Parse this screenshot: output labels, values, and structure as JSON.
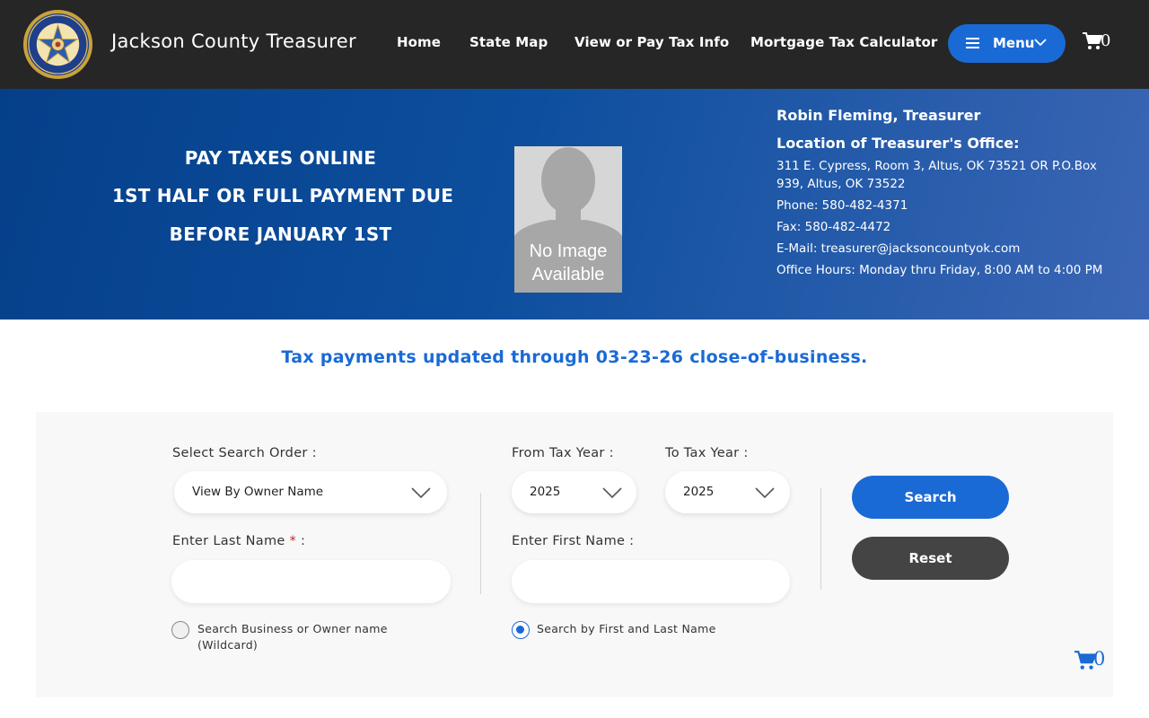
{
  "header": {
    "site_title": "Jackson County Treasurer",
    "nav": [
      {
        "label": "Home"
      },
      {
        "label": "State Map"
      },
      {
        "label": "View or Pay Tax Info"
      },
      {
        "label": "Mortgage Tax Calculator"
      }
    ],
    "menu_label": "Menu",
    "cart_count": "0"
  },
  "banner": {
    "promo_lines": [
      "PAY TAXES ONLINE",
      "1ST HALF OR FULL PAYMENT DUE",
      "BEFORE JANUARY 1ST"
    ],
    "no_image_text": [
      "No Image",
      "Available"
    ],
    "treasurer_name": "Robin Fleming, Treasurer",
    "location_heading": "Location of Treasurer's Office:",
    "address": "311 E. Cypress, Room 3, Altus, OK 73521 OR P.O.Box 939, Altus, OK 73522",
    "phone": "Phone: 580-482-4371",
    "fax": "Fax: 580-482-4472",
    "email": "E-Mail: treasurer@jacksoncountyok.com",
    "hours": "Office Hours: Monday thru Friday, 8:00 AM to 4:00 PM"
  },
  "notice": "Tax payments updated through 03-23-26 close-of-business.",
  "search": {
    "order_label": "Select Search Order :",
    "order_value": "View By Owner Name",
    "from_year_label": "From Tax Year :",
    "from_year_value": "2025",
    "to_year_label": "To Tax Year :",
    "to_year_value": "2025",
    "last_name_label": "Enter Last Name",
    "required_mark": "*",
    "label_suffix": ":",
    "last_name_value": "",
    "first_name_label": "Enter First Name :",
    "first_name_value": "",
    "search_button": "Search",
    "reset_button": "Reset",
    "radio_wildcard_line1": "Search Business or Owner name",
    "radio_wildcard_line2": "(Wildcard)",
    "radio_firstlast": "Search by First and Last Name",
    "selected_radio": "firstlast"
  },
  "floating_cart_count": "0",
  "colors": {
    "header_bg": "#262626",
    "accent": "#1a6ad6",
    "reset": "#444444",
    "banner_start": "#053f8a",
    "banner_end": "#3b66b5"
  }
}
